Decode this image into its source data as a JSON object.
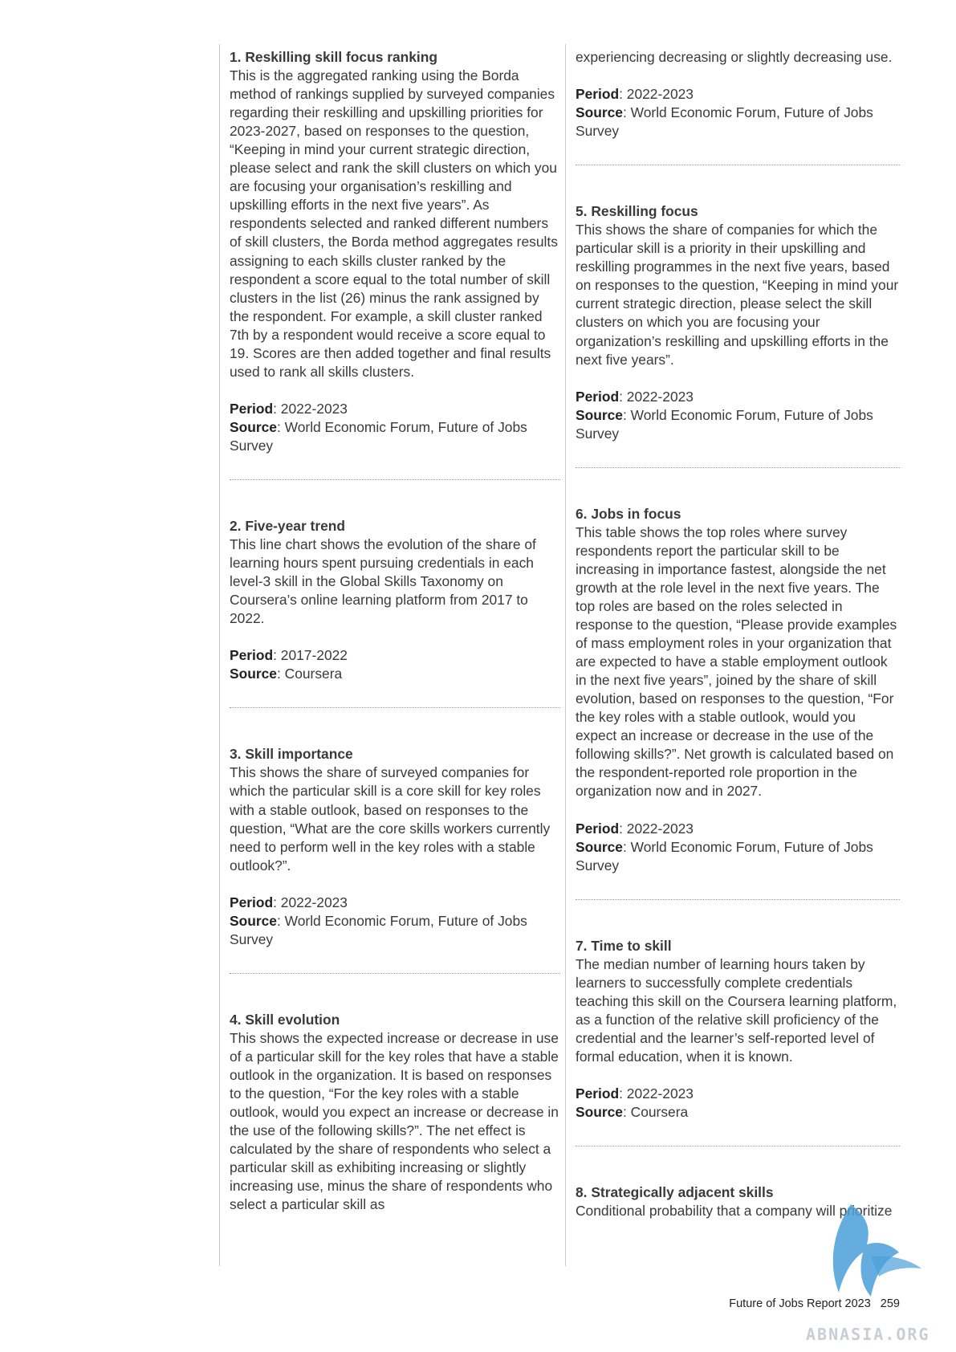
{
  "left_column": [
    {
      "heading": "1. Reskilling skill focus ranking",
      "description": "This is the aggregated ranking using the Borda method of rankings supplied by surveyed companies regarding their reskilling and upskilling priorities for 2023-2027, based on responses to the question, “Keeping in mind your current strategic direction, please select and rank the skill clusters on which you are focusing your organisation’s reskilling and upskilling efforts in the next five years”. As respondents selected and ranked different numbers of skill clusters, the Borda method aggregates results assigning to each skills cluster ranked by the respondent a score equal to the total number of skill clusters in the list (26) minus the rank assigned by the respondent. For example, a skill cluster ranked 7th by a respondent would receive a score equal to 19. Scores are then added together and final results used to rank all skills clusters.",
      "period_label": "Period",
      "period": ": 2022-2023",
      "source_label": "Source",
      "source": ": World Economic Forum, Future of Jobs Survey"
    },
    {
      "heading": "2. Five-year trend",
      "description": "This line chart shows the evolution of the share of learning hours spent pursuing credentials in each level-3 skill in the Global Skills Taxonomy on Coursera’s online learning platform from 2017 to 2022.",
      "period_label": "Period",
      "period": ": 2017-2022",
      "source_label": "Source",
      "source": ": Coursera"
    },
    {
      "heading": "3. Skill importance",
      "description": "This shows the share of surveyed companies for which the particular skill is a core skill for key roles with a stable outlook, based on responses to the question, “What are the core skills workers currently need to perform well in the key roles with a stable outlook?”.",
      "period_label": "Period",
      "period": ": 2022-2023",
      "source_label": "Source",
      "source": ": World Economic Forum, Future of Jobs Survey"
    },
    {
      "heading": "4. Skill evolution",
      "description": "This shows the expected increase or decrease in use of a particular skill for the key roles that have a stable outlook in the organization. It is based on responses to the question, “For the key roles with a stable outlook, would you expect an increase or decrease in the use of the following skills?”. The net effect is calculated by the share of respondents who select a particular skill as exhibiting increasing or slightly increasing use, minus the share of respondents who select a particular skill as"
    }
  ],
  "right_column": {
    "continuation": "experiencing decreasing or slightly decreasing use.",
    "continuation_period_label": "Period",
    "continuation_period": ": 2022-2023",
    "continuation_source_label": "Source",
    "continuation_source": ": World Economic Forum, Future of Jobs Survey",
    "sections": [
      {
        "heading": "5. Reskilling focus",
        "description": "This shows the share of companies for which the particular skill is a priority in their upskilling and reskilling programmes in the next five years, based on responses to the question, “Keeping in mind your current strategic direction, please select the skill clusters on which you are focusing your organization’s reskilling and upskilling efforts in the next five years”.",
        "period_label": "Period",
        "period": ": 2022-2023",
        "source_label": "Source",
        "source": ": World Economic Forum, Future of Jobs Survey"
      },
      {
        "heading": "6. Jobs in focus",
        "description": "This table shows the top roles where survey respondents report the particular skill to be increasing in importance fastest, alongside the net growth at the role level in the next five years. The top roles are based on the roles selected in response to the question, “Please provide examples of mass employment roles in your organization that are expected to have a stable employment outlook in the next five years”, joined by the share of skill evolution, based on responses to the question, “For the key roles with a stable outlook, would you expect an increase or decrease in the use of the following skills?”. Net growth is calculated based on the respondent-reported role proportion in the organization now and in 2027.",
        "period_label": "Period",
        "period": ": 2022-2023",
        "source_label": "Source",
        "source": ": World Economic Forum, Future of Jobs Survey"
      },
      {
        "heading": "7. Time to skill",
        "description": "The median number of learning hours taken by learners to successfully complete credentials teaching this skill on the Coursera learning platform, as a function of the relative skill proficiency of the credential and the learner’s self-reported level of formal education, when it is known.",
        "period_label": "Period",
        "period": ": 2022-2023",
        "source_label": "Source",
        "source": ": Coursera"
      },
      {
        "heading": "8. Strategically adjacent skills",
        "description": "Conditional probability that a company will prioritize"
      }
    ]
  },
  "footer": {
    "report_title": "Future of Jobs Report 2023",
    "page_number": "259"
  },
  "watermark": {
    "text": "ABNASIA.ORG",
    "color": "#4a9fd8"
  }
}
